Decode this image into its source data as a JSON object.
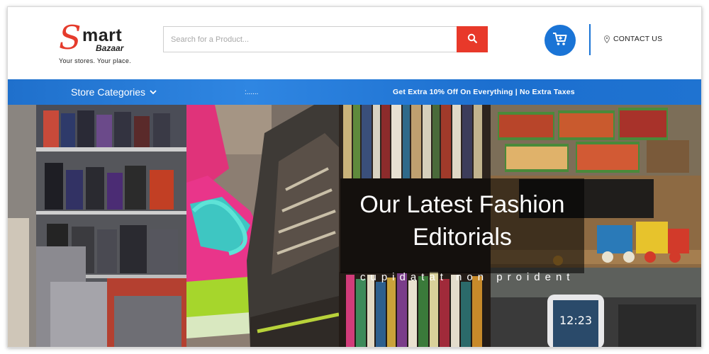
{
  "brand": {
    "logo_mark": "S",
    "logo_word": "mart",
    "logo_sub": "Bazaar",
    "tagline": "Your stores. Your place."
  },
  "search": {
    "placeholder": "Search for a Product...",
    "button_icon": "search-icon"
  },
  "header_actions": {
    "cart_icon": "cart-icon",
    "contact_icon": "map-pin-icon",
    "contact_label": "CONTACT US"
  },
  "nav": {
    "store_categories_label": "Store Categories",
    "dots": ":......",
    "promo": "Get Extra 10% Off On Everything | No Extra Taxes"
  },
  "hero": {
    "title_line1": "Our Latest Fashion",
    "title_line2": "Editorials",
    "subtitle": "cupidatat non proident",
    "panels": [
      "luggage-photo",
      "sneakers-photo",
      "books-and-toys-photo",
      "grocery-and-phone-photo"
    ]
  },
  "colors": {
    "accent_blue": "#1a74d6",
    "accent_red": "#e8392a"
  }
}
